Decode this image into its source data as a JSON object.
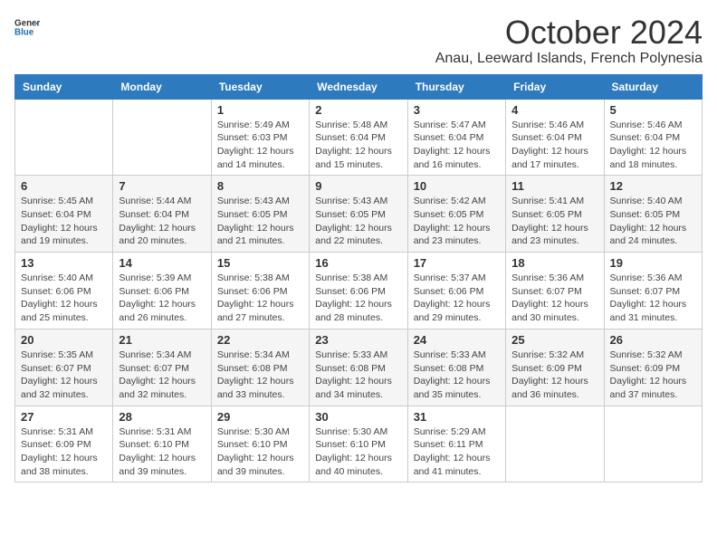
{
  "logo": {
    "general": "General",
    "blue": "Blue"
  },
  "header": {
    "month_year": "October 2024",
    "location": "Anau, Leeward Islands, French Polynesia"
  },
  "days_of_week": [
    "Sunday",
    "Monday",
    "Tuesday",
    "Wednesday",
    "Thursday",
    "Friday",
    "Saturday"
  ],
  "weeks": [
    [
      {
        "day": "",
        "info": ""
      },
      {
        "day": "",
        "info": ""
      },
      {
        "day": "1",
        "info": "Sunrise: 5:49 AM\nSunset: 6:03 PM\nDaylight: 12 hours and 14 minutes."
      },
      {
        "day": "2",
        "info": "Sunrise: 5:48 AM\nSunset: 6:04 PM\nDaylight: 12 hours and 15 minutes."
      },
      {
        "day": "3",
        "info": "Sunrise: 5:47 AM\nSunset: 6:04 PM\nDaylight: 12 hours and 16 minutes."
      },
      {
        "day": "4",
        "info": "Sunrise: 5:46 AM\nSunset: 6:04 PM\nDaylight: 12 hours and 17 minutes."
      },
      {
        "day": "5",
        "info": "Sunrise: 5:46 AM\nSunset: 6:04 PM\nDaylight: 12 hours and 18 minutes."
      }
    ],
    [
      {
        "day": "6",
        "info": "Sunrise: 5:45 AM\nSunset: 6:04 PM\nDaylight: 12 hours and 19 minutes."
      },
      {
        "day": "7",
        "info": "Sunrise: 5:44 AM\nSunset: 6:04 PM\nDaylight: 12 hours and 20 minutes."
      },
      {
        "day": "8",
        "info": "Sunrise: 5:43 AM\nSunset: 6:05 PM\nDaylight: 12 hours and 21 minutes."
      },
      {
        "day": "9",
        "info": "Sunrise: 5:43 AM\nSunset: 6:05 PM\nDaylight: 12 hours and 22 minutes."
      },
      {
        "day": "10",
        "info": "Sunrise: 5:42 AM\nSunset: 6:05 PM\nDaylight: 12 hours and 23 minutes."
      },
      {
        "day": "11",
        "info": "Sunrise: 5:41 AM\nSunset: 6:05 PM\nDaylight: 12 hours and 23 minutes."
      },
      {
        "day": "12",
        "info": "Sunrise: 5:40 AM\nSunset: 6:05 PM\nDaylight: 12 hours and 24 minutes."
      }
    ],
    [
      {
        "day": "13",
        "info": "Sunrise: 5:40 AM\nSunset: 6:06 PM\nDaylight: 12 hours and 25 minutes."
      },
      {
        "day": "14",
        "info": "Sunrise: 5:39 AM\nSunset: 6:06 PM\nDaylight: 12 hours and 26 minutes."
      },
      {
        "day": "15",
        "info": "Sunrise: 5:38 AM\nSunset: 6:06 PM\nDaylight: 12 hours and 27 minutes."
      },
      {
        "day": "16",
        "info": "Sunrise: 5:38 AM\nSunset: 6:06 PM\nDaylight: 12 hours and 28 minutes."
      },
      {
        "day": "17",
        "info": "Sunrise: 5:37 AM\nSunset: 6:06 PM\nDaylight: 12 hours and 29 minutes."
      },
      {
        "day": "18",
        "info": "Sunrise: 5:36 AM\nSunset: 6:07 PM\nDaylight: 12 hours and 30 minutes."
      },
      {
        "day": "19",
        "info": "Sunrise: 5:36 AM\nSunset: 6:07 PM\nDaylight: 12 hours and 31 minutes."
      }
    ],
    [
      {
        "day": "20",
        "info": "Sunrise: 5:35 AM\nSunset: 6:07 PM\nDaylight: 12 hours and 32 minutes."
      },
      {
        "day": "21",
        "info": "Sunrise: 5:34 AM\nSunset: 6:07 PM\nDaylight: 12 hours and 32 minutes."
      },
      {
        "day": "22",
        "info": "Sunrise: 5:34 AM\nSunset: 6:08 PM\nDaylight: 12 hours and 33 minutes."
      },
      {
        "day": "23",
        "info": "Sunrise: 5:33 AM\nSunset: 6:08 PM\nDaylight: 12 hours and 34 minutes."
      },
      {
        "day": "24",
        "info": "Sunrise: 5:33 AM\nSunset: 6:08 PM\nDaylight: 12 hours and 35 minutes."
      },
      {
        "day": "25",
        "info": "Sunrise: 5:32 AM\nSunset: 6:09 PM\nDaylight: 12 hours and 36 minutes."
      },
      {
        "day": "26",
        "info": "Sunrise: 5:32 AM\nSunset: 6:09 PM\nDaylight: 12 hours and 37 minutes."
      }
    ],
    [
      {
        "day": "27",
        "info": "Sunrise: 5:31 AM\nSunset: 6:09 PM\nDaylight: 12 hours and 38 minutes."
      },
      {
        "day": "28",
        "info": "Sunrise: 5:31 AM\nSunset: 6:10 PM\nDaylight: 12 hours and 39 minutes."
      },
      {
        "day": "29",
        "info": "Sunrise: 5:30 AM\nSunset: 6:10 PM\nDaylight: 12 hours and 39 minutes."
      },
      {
        "day": "30",
        "info": "Sunrise: 5:30 AM\nSunset: 6:10 PM\nDaylight: 12 hours and 40 minutes."
      },
      {
        "day": "31",
        "info": "Sunrise: 5:29 AM\nSunset: 6:11 PM\nDaylight: 12 hours and 41 minutes."
      },
      {
        "day": "",
        "info": ""
      },
      {
        "day": "",
        "info": ""
      }
    ]
  ]
}
